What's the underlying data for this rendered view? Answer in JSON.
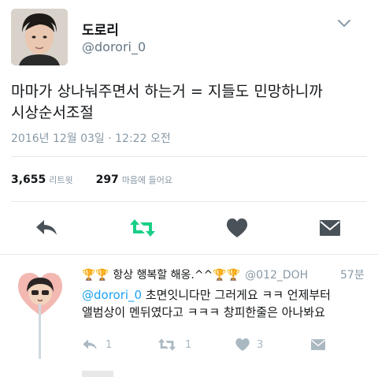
{
  "tweet": {
    "display_name": "도로리",
    "handle": "@dorori_0",
    "text_line1": "마마가 상나눠주면서 하는거 = 지들도 민망하니까",
    "text_line2": "시상순서조절",
    "timestamp": "2016년 12월 03일 · 12:22 오전",
    "retweets_count": "3,655",
    "retweets_label": "리트윗",
    "likes_count": "297",
    "likes_label": "마음에 들어요"
  },
  "reply": {
    "name_prefix": "🏆🏆 항상 행복할 해옹.^^🏆🏆",
    "handle": "@012_DOH",
    "time": "57분",
    "mention": "@dorori_0",
    "text_line1_rest": " 초면잇니다만 그러게요 ㅋㅋ 언제부터",
    "text_line2": "앨범상이 멘뒤였다고 ㅋㅋㅋ 창피한줄은 아나봐요",
    "reply_count": "1",
    "retweet_count": "1",
    "like_count": "3"
  },
  "colors": {
    "retweet_active": "#19cf86",
    "icon_dark": "#4a5259",
    "icon_light": "#aab8c2",
    "mention": "#1da1f2"
  },
  "icons": [
    "chevron-down-icon",
    "reply-icon",
    "retweet-icon",
    "heart-icon",
    "message-icon"
  ]
}
